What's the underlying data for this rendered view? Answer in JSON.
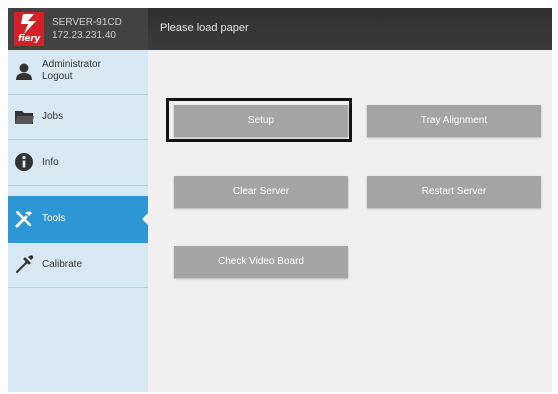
{
  "header": {
    "logo_text": "fiery",
    "server_name": "SERVER-91CD",
    "server_ip": "172.23.231.40",
    "status_message": "Please load paper"
  },
  "sidebar": {
    "items": [
      {
        "label": "Administrator\nLogout",
        "icon": "user-icon"
      },
      {
        "label": "Jobs",
        "icon": "folder-icon"
      },
      {
        "label": "Info",
        "icon": "info-icon"
      },
      {
        "label": "Tools",
        "icon": "tools-icon",
        "active": true
      },
      {
        "label": "Calibrate",
        "icon": "calibrate-icon"
      }
    ]
  },
  "main": {
    "buttons": [
      {
        "label": "Setup",
        "highlighted": true
      },
      {
        "label": "Tray Alignment"
      },
      {
        "label": "Clear Server"
      },
      {
        "label": "Restart Server"
      },
      {
        "label": "Check Video Board"
      }
    ]
  },
  "colors": {
    "header_bg": "#3a3a3a",
    "logo_red": "#d42027",
    "sidebar_bg": "#d7e8f3",
    "active_blue": "#2d96d4",
    "button_gray": "#a4a4a4",
    "main_bg": "#f0f0f0"
  }
}
